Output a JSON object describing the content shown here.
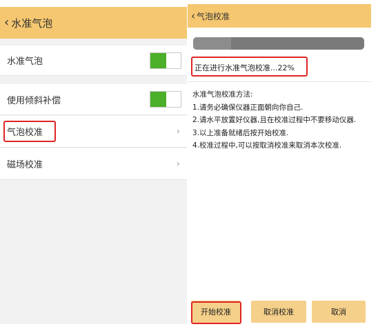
{
  "left": {
    "title": "水准气泡",
    "back_icon": "‹",
    "items": [
      {
        "label": "水准气泡",
        "toggle": true
      },
      {
        "label": "使用倾斜补偿",
        "toggle": true
      },
      {
        "label": "气泡校准",
        "chevron": "›"
      },
      {
        "label": "磁场校准",
        "chevron": "›"
      }
    ],
    "accent_color": "#f5c770",
    "toggle_color": "#4caf2a",
    "highlight_color": "#e02424"
  },
  "right": {
    "title": "气泡校准",
    "back_icon": "‹",
    "progress": 0.22,
    "status_text": "正在进行水准气泡校准...22%",
    "instructions": {
      "heading": "水准气泡校准方法:",
      "steps": [
        "1.请务必确保仪器正面朝向你自己.",
        "2.请水平放置好仪器,且在校准过程中不要移动仪器.",
        "3.以上准备就绪后按开始校准.",
        "4.校准过程中,可以按取消校准来取消本次校准."
      ]
    },
    "buttons": {
      "start": "开始校准",
      "cancel_calibration": "取消校准",
      "cancel": "取消"
    }
  }
}
